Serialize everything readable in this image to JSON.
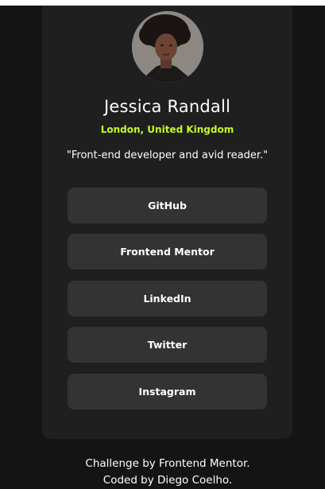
{
  "colors": {
    "background": "#141414",
    "card": "#1f1f1f",
    "button": "#333333",
    "accent": "#c4f82a",
    "text": "#ffffff"
  },
  "profile": {
    "avatar_alt": "Jessica Randall",
    "name": "Jessica Randall",
    "location": "London, United Kingdom",
    "bio": "\"Front-end developer and avid reader.\""
  },
  "links": [
    {
      "label": "GitHub"
    },
    {
      "label": "Frontend Mentor"
    },
    {
      "label": "LinkedIn"
    },
    {
      "label": "Twitter"
    },
    {
      "label": "Instagram"
    }
  ],
  "footer": {
    "line1": "Challenge by Frontend Mentor.",
    "line2": "Coded by Diego Coelho."
  }
}
